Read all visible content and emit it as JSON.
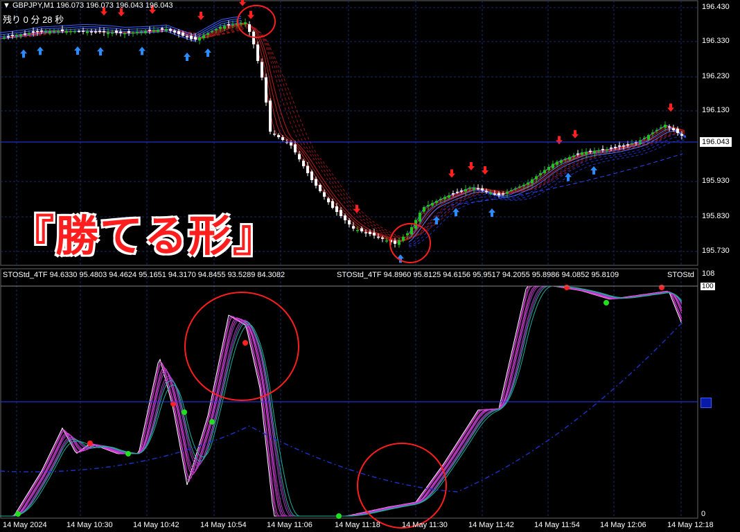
{
  "header": {
    "symbol_line": "GBPJPY,M1  196.073 196.073 196.043 196.043",
    "countdown": "残り 0 分 28 秒"
  },
  "banner_text": "『勝てる形』",
  "price_axis": [
    "196.430",
    "196.330",
    "196.230",
    "196.130",
    "196.030",
    "195.930",
    "195.830",
    "195.730"
  ],
  "current_price": "196.043",
  "indicator": {
    "label_a": "STOStd_4TF 94.6330 95.4803 94.4624 95.1651 94.3170 94.8455 93.5289 84.3082",
    "label_b": "STOStd_4TF 94.8960 95.8125 94.6156 95.9517 94.2055 95.8986 94.0852 95.8109",
    "label_c": "STOStd",
    "scale_top": "108",
    "level_100": "100",
    "level_0": "0"
  },
  "time_axis": [
    "14 May 2024",
    "14 May 10:30",
    "14 May 10:42",
    "14 May 10:54",
    "14 May 11:06",
    "14 May 11:18",
    "14 May 11:30",
    "14 May 11:42",
    "14 May 11:54",
    "14 May 12:06",
    "14 May 12:18"
  ],
  "colors": {
    "bull": "#22c022",
    "bear": "#ffffff",
    "ribbon_red": "#d02020",
    "ribbon_blue": "#2040ff",
    "grid": "#1a2a6a",
    "circle": "#ff1e1e",
    "magenta": "#ff40ff",
    "teal": "#20c0a0"
  }
}
